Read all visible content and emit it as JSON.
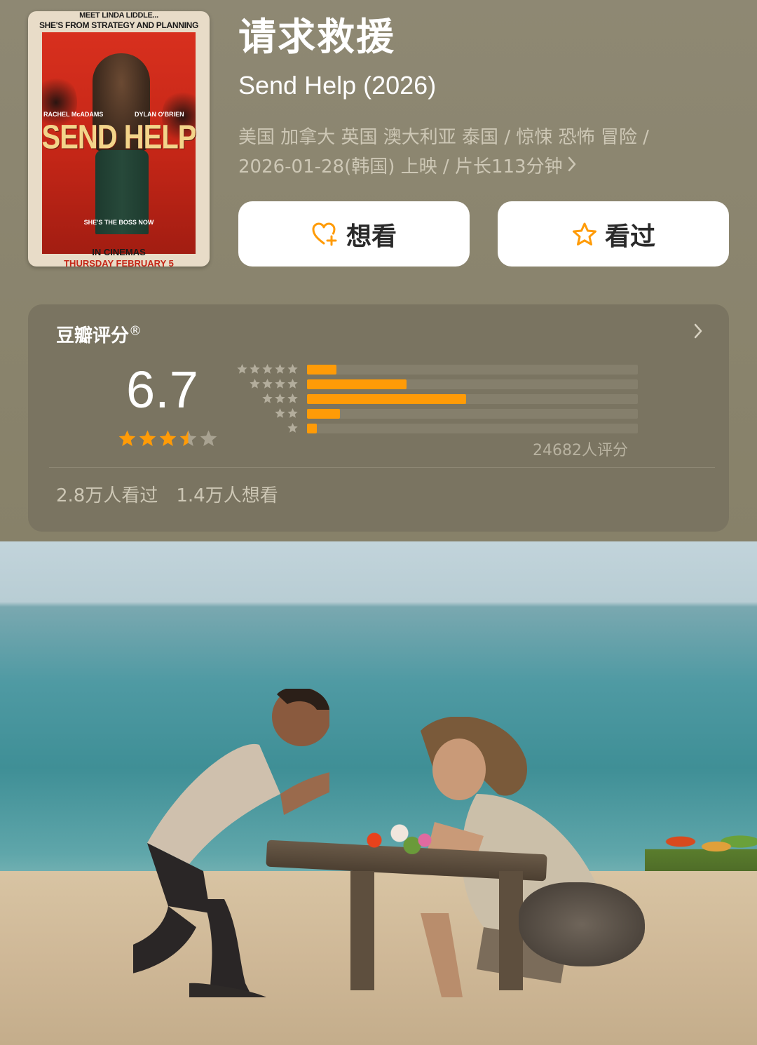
{
  "movie": {
    "title_cn": "请求救援",
    "title_en": "Send Help (2026)",
    "meta_line1": "美国 加拿大 英国 澳大利亚 泰国 / 惊悚 恐怖 冒险 /",
    "meta_line2": "2026-01-28(韩国) 上映 / 片长113分钟",
    "meta_chevron_icon": "chevron-right-icon"
  },
  "poster": {
    "tagline1": "MEET LINDA LIDDLE...",
    "tagline2": "SHE'S FROM STRATEGY AND PLANNING",
    "actor1": "RACHEL McADAMS",
    "actor2": "DYLAN O'BRIEN",
    "title": "SEND HELP",
    "boss_line": "SHE'S THE BOSS NOW",
    "release_line1": "IN CINEMAS",
    "release_line2": "THURSDAY FEBRUARY 5"
  },
  "actions": {
    "want_label": "想看",
    "want_icon": "heart-plus-icon",
    "seen_label": "看过",
    "seen_icon": "star-outline-icon",
    "icon_color": "#ff9b07"
  },
  "rating": {
    "title": "豆瓣评分",
    "registered_mark": "®",
    "score": "6.7",
    "stars_value": 3.5,
    "stars_max": 5,
    "distribution": [
      {
        "stars": 5,
        "fraction": 0.09
      },
      {
        "stars": 4,
        "fraction": 0.3
      },
      {
        "stars": 3,
        "fraction": 0.48
      },
      {
        "stars": 2,
        "fraction": 0.1
      },
      {
        "stars": 1,
        "fraction": 0.03
      }
    ],
    "count_text": "24682人评分",
    "seen_stat": "2.8万人看过",
    "want_stat": "1.4万人想看",
    "accent_color": "#ff9b07"
  }
}
